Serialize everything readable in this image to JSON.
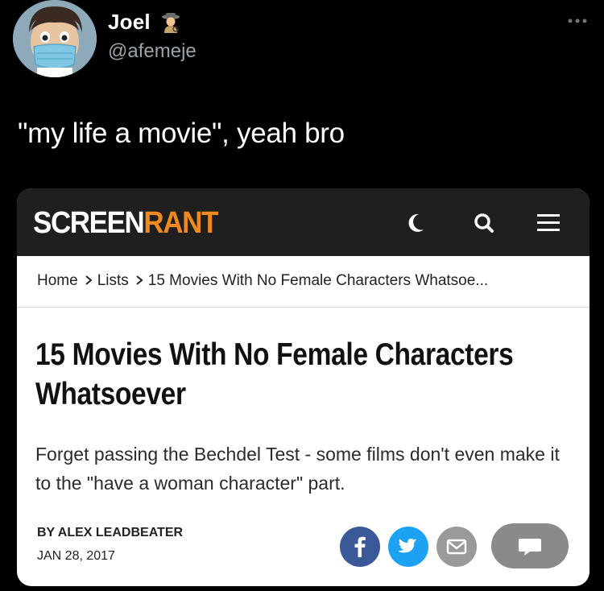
{
  "tweet": {
    "display_name": "Joel",
    "name_emoji": "detective-emoji",
    "handle": "@afemeje",
    "text": "\"my life a movie\", yeah bro",
    "avatar": "masked-anime-avatar"
  },
  "card": {
    "logo": {
      "part1": "SCREEN",
      "part2": "RANT"
    },
    "header_icons": [
      "moon-icon",
      "search-icon",
      "menu-icon"
    ],
    "breadcrumb": {
      "home": "Home",
      "lists": "Lists",
      "current": "15 Movies With No Female Characters Whatsoe..."
    },
    "headline": "15 Movies With No Female Characters Whatsoever",
    "subhead": "Forget passing the Bechdel Test - some films don't even make it to the \"have a woman character\" part.",
    "byline": "BY ALEX LEADBEATER",
    "date": "JAN 28, 2017",
    "share_icons": [
      "facebook-icon",
      "twitter-icon",
      "email-icon",
      "comment-icon"
    ]
  },
  "colors": {
    "background": "#000000",
    "card_header": "#1f1f1f",
    "brand_orange": "#f08a1e",
    "facebook": "#3b5998",
    "twitter": "#1da1f2",
    "email": "#9a9a9a",
    "comments": "#8a8a8a"
  }
}
